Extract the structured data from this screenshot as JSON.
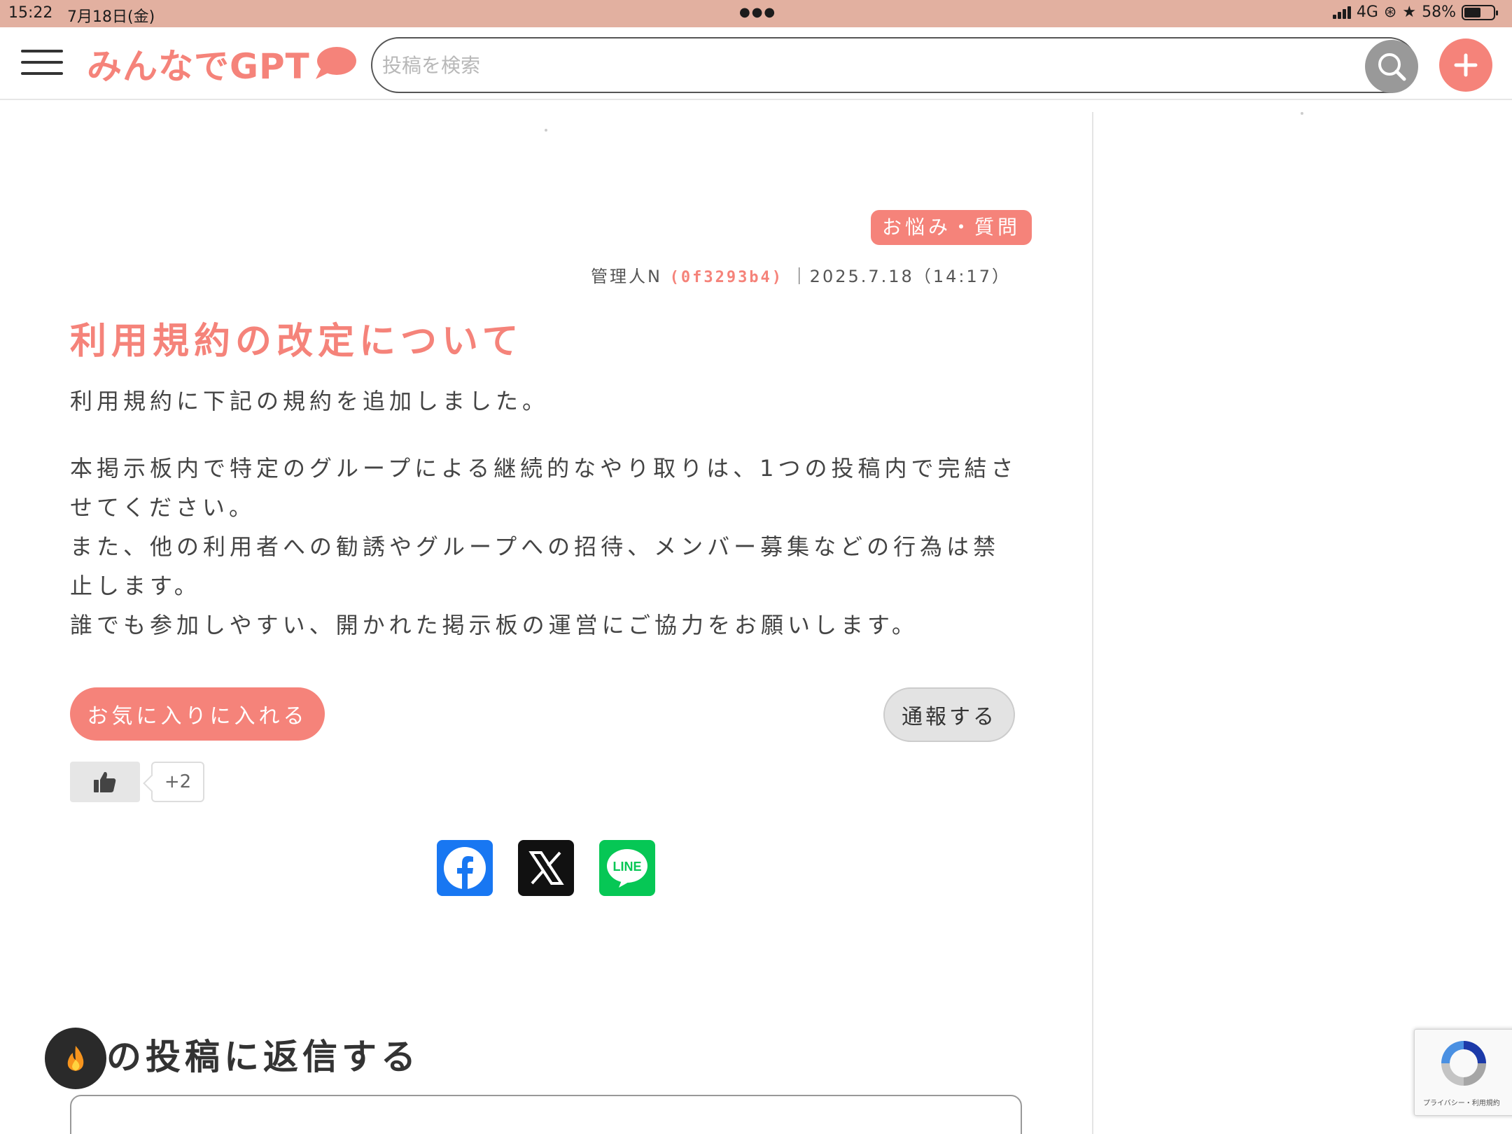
{
  "status_bar": {
    "time": "15:22",
    "date": "7月18日(金)",
    "network": "4G",
    "battery": "58%",
    "battery_level": 0.58
  },
  "header": {
    "logo_text": "みんなでGPT",
    "search_placeholder": "投稿を検索",
    "search_value": "",
    "brand_color": "#f5837a"
  },
  "post": {
    "category": "お悩み・質問",
    "author": "管理人N",
    "author_id": "(0f3293b4)",
    "datetime": "｜2025.7.18（14:17）",
    "title": "利用規約の改定について",
    "body": [
      "利用規約に下記の規約を追加しました。",
      "本掲示板内で特定のグループによる継続的なやり取りは、1つの投稿内で完結させてください。",
      "また、他の利用者への勧誘やグループへの招待、メンバー募集などの行為は禁止します。",
      "誰でも参加しやすい、開かれた掲示板の運営にご協力をお願いします。"
    ],
    "favorite_label": "お気に入りに入れる",
    "report_label": "通報する",
    "like_count": "+2"
  },
  "share": [
    "facebook-icon",
    "x-icon",
    "line-icon"
  ],
  "reply": {
    "heading": "の投稿に返信する"
  },
  "recaptcha": {
    "links": "プライバシー・利用規約"
  }
}
